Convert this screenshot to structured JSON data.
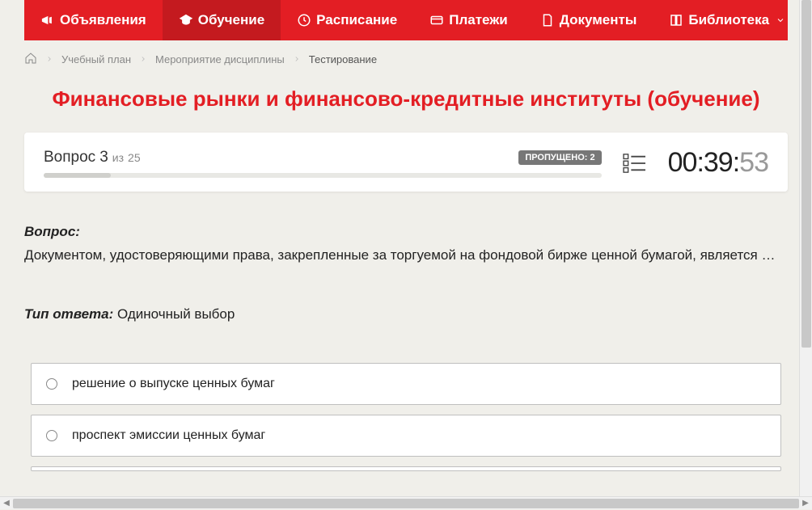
{
  "nav": {
    "items": [
      {
        "label": "Объявления",
        "icon": "megaphone"
      },
      {
        "label": "Обучение",
        "icon": "cap",
        "active": true
      },
      {
        "label": "Расписание",
        "icon": "clock"
      },
      {
        "label": "Платежи",
        "icon": "card"
      },
      {
        "label": "Документы",
        "icon": "doc"
      },
      {
        "label": "Библиотека",
        "icon": "book",
        "dropdown": true
      }
    ]
  },
  "breadcrumb": {
    "items": [
      "Учебный план",
      "Мероприятие дисциплины"
    ],
    "current": "Тестирование"
  },
  "page_title": "Финансовые рынки и финансово-кредитные институты (обучение)",
  "progress": {
    "question_word": "Вопрос",
    "current": 3,
    "of_word": "из",
    "total": 25,
    "skipped_label": "ПРОПУЩЕНО: 2",
    "percent": 12
  },
  "timer": {
    "mm": "00",
    "ss1": "39",
    "ss2": "53"
  },
  "question": {
    "label": "Вопрос:",
    "text": "Документом, удостоверяющими права, закрепленные за торгуемой на фондовой бирже ценной бумагой, является …"
  },
  "answer_type": {
    "label": "Тип ответа:",
    "value": "Одиночный выбор"
  },
  "answers": [
    {
      "text": "решение о выпуске ценных бумаг"
    },
    {
      "text": "проспект эмиссии ценных бумаг"
    }
  ]
}
